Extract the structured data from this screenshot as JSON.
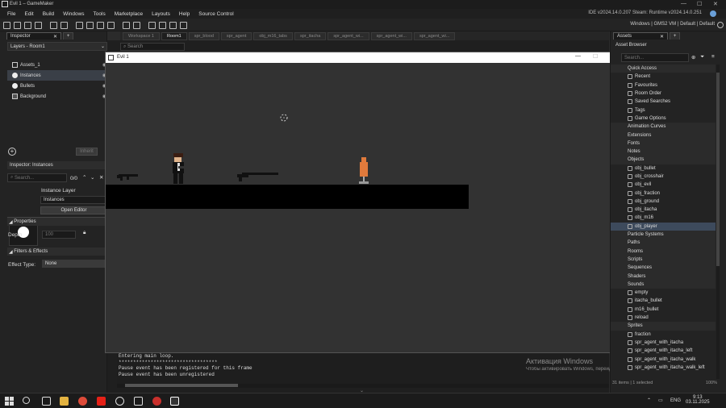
{
  "window": {
    "title": "Evil 1 – GameMaker",
    "minimize": "—",
    "maximize": "☐",
    "close": "✕"
  },
  "menu": [
    "File",
    "Edit",
    "Build",
    "Windows",
    "Tools",
    "Marketplace",
    "Layouts",
    "Help",
    "Source Control"
  ],
  "ide_version": "IDE v2024.14.0.207 Steam: Runtime v2024.14.0.251",
  "toolbar": {
    "target": "Windows",
    "vm": "GMS2 VM",
    "config1": "Default",
    "config2": "Default"
  },
  "inspector": {
    "tab": "Inspector",
    "layers_title": "Layers - Room1",
    "layers": [
      "Assets_1",
      "Instances",
      "Bullets",
      "Background"
    ],
    "selected_layer": "Instances",
    "inherit_btn": "Inherit",
    "instances_header": "Inspector: Instances",
    "search_placeholder": "Search...",
    "count": "0/0",
    "instance_layer_label": "Instance Layer",
    "instance_layer_value": "Instances",
    "open_editor": "Open Editor",
    "properties": "Properties",
    "depth_label": "Depth",
    "depth_value": "100",
    "filters": "Filters & Effects",
    "effect_type_label": "Effect Type:",
    "effect_type_value": "None"
  },
  "workspace_tabs": [
    "Workspace 1",
    "Room1",
    "spr_blood",
    "spr_agent",
    "obj_m16_tabs",
    "spr_itacha",
    "spr_agent_wi...",
    "spr_agent_wi...",
    "spr_agent_wi..."
  ],
  "room_search": "Search",
  "game_window": {
    "title": "Evil 1"
  },
  "output_lines": [
    "Entering main loop.",
    "**********************************",
    "Pause event has been registered for this frame",
    "Pause event has been unregistered"
  ],
  "activation": {
    "line1": "Активация Windows",
    "line2": "Чтобы активировать Windows, перейдите в раздел «Параметры»."
  },
  "assets": {
    "tab": "Assets",
    "browser_title": "Asset Browser",
    "search_placeholder": "Search...",
    "rows": [
      {
        "label": "Quick Access",
        "folder": true
      },
      {
        "label": "Recent",
        "folder": false
      },
      {
        "label": "Favourites",
        "folder": false
      },
      {
        "label": "Room Order",
        "folder": false
      },
      {
        "label": "Saved Searches",
        "folder": false
      },
      {
        "label": "Tags",
        "folder": false
      },
      {
        "label": "Game Options",
        "folder": false
      },
      {
        "label": "Animation Curves",
        "folder": true
      },
      {
        "label": "Extensions",
        "folder": true
      },
      {
        "label": "Fonts",
        "folder": true
      },
      {
        "label": "Notes",
        "folder": true
      },
      {
        "label": "Objects",
        "folder": true
      },
      {
        "label": "obj_bullet",
        "folder": false
      },
      {
        "label": "obj_crosshair",
        "folder": false
      },
      {
        "label": "obj_evil",
        "folder": false
      },
      {
        "label": "obj_fraction",
        "folder": false
      },
      {
        "label": "obj_ground",
        "folder": false
      },
      {
        "label": "obj_itacha",
        "folder": false
      },
      {
        "label": "obj_m16",
        "folder": false
      },
      {
        "label": "obj_player",
        "folder": false,
        "selected": true
      },
      {
        "label": "Particle Systems",
        "folder": true
      },
      {
        "label": "Paths",
        "folder": true
      },
      {
        "label": "Rooms",
        "folder": true
      },
      {
        "label": "Scripts",
        "folder": true
      },
      {
        "label": "Sequences",
        "folder": true
      },
      {
        "label": "Shaders",
        "folder": true
      },
      {
        "label": "Sounds",
        "folder": true
      },
      {
        "label": "empty",
        "folder": false
      },
      {
        "label": "itacha_bullet",
        "folder": false
      },
      {
        "label": "m16_bullet",
        "folder": false
      },
      {
        "label": "reload",
        "folder": false
      },
      {
        "label": "Sprites",
        "folder": true
      },
      {
        "label": "fraction",
        "folder": false
      },
      {
        "label": "spr_agent_with_itacha",
        "folder": false
      },
      {
        "label": "spr_agent_with_itacha_left",
        "folder": false
      },
      {
        "label": "spr_agent_with_itacha_walk",
        "folder": false
      },
      {
        "label": "spr_agent_with_itacha_walk_left",
        "folder": false
      }
    ],
    "footer_items": "31 items",
    "footer_selected": "1 selected",
    "zoom": "100%"
  },
  "taskbar": {
    "lang": "ENG",
    "time": "9:13",
    "date": "03.11.2025"
  }
}
